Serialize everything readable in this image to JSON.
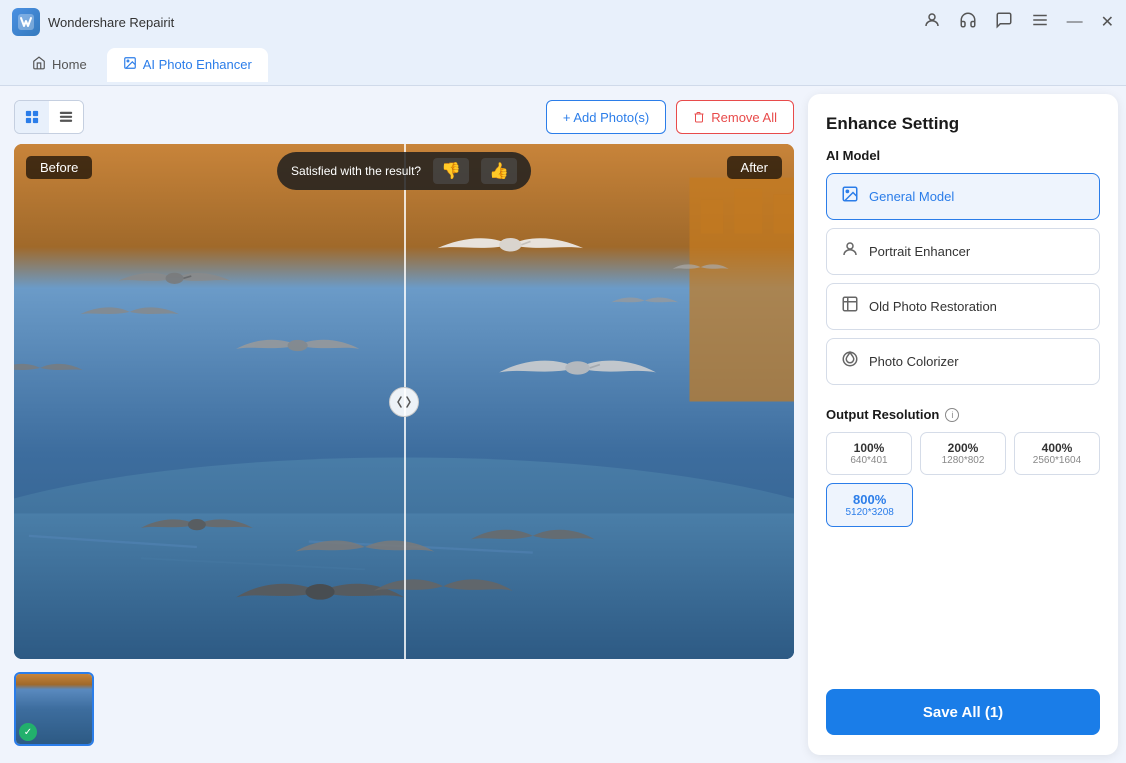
{
  "app": {
    "name": "Wondershare Repairit",
    "logo_char": "W"
  },
  "titlebar": {
    "icons": [
      "person",
      "headset",
      "chat",
      "menu"
    ],
    "win_buttons": [
      "minimize",
      "close"
    ]
  },
  "tabs": [
    {
      "id": "home",
      "label": "Home",
      "icon": "🏠",
      "active": false
    },
    {
      "id": "ai-photo",
      "label": "AI Photo Enhancer",
      "icon": "✨",
      "active": true
    }
  ],
  "toolbar": {
    "add_label": "+ Add Photo(s)",
    "remove_label": "🗑 Remove All"
  },
  "viewer": {
    "label_before": "Before",
    "label_after": "After",
    "satisfaction_text": "Satisfied with the result?"
  },
  "right_panel": {
    "title": "Enhance Setting",
    "ai_model_label": "AI Model",
    "models": [
      {
        "id": "general",
        "label": "General Model",
        "icon": "img",
        "selected": true
      },
      {
        "id": "portrait",
        "label": "Portrait Enhancer",
        "icon": "person",
        "selected": false
      },
      {
        "id": "old-photo",
        "label": "Old Photo Restoration",
        "icon": "photo",
        "selected": false
      },
      {
        "id": "colorizer",
        "label": "Photo Colorizer",
        "icon": "palette",
        "selected": false
      }
    ],
    "output_resolution_label": "Output Resolution",
    "resolutions": [
      {
        "id": "100",
        "label": "100%",
        "sub": "640*401",
        "selected": false
      },
      {
        "id": "200",
        "label": "200%",
        "sub": "1280*802",
        "selected": false
      },
      {
        "id": "400",
        "label": "400%",
        "sub": "2560*1604",
        "selected": false
      },
      {
        "id": "800",
        "label": "800%",
        "sub": "5120*3208",
        "selected": true
      }
    ],
    "save_label": "Save All (1)"
  }
}
